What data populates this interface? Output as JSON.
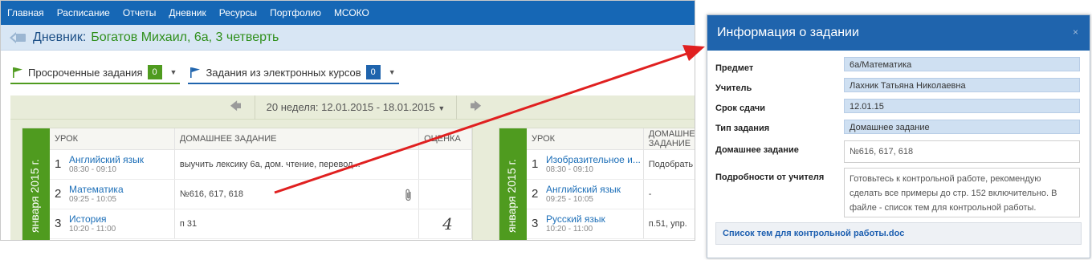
{
  "nav": [
    "Главная",
    "Расписание",
    "Отчеты",
    "Дневник",
    "Ресурсы",
    "Портфолио",
    "МСОКО"
  ],
  "title": {
    "prefix": "Дневник:",
    "name": "Богатов Михаил, 6а, 3 четверть"
  },
  "filters": [
    {
      "label": "Просроченные задания",
      "count": "0"
    },
    {
      "label": "Задания из электронных курсов",
      "count": "0"
    }
  ],
  "week": {
    "label": "20 неделя: 12.01.2015 - 18.01.2015"
  },
  "day1": {
    "date": "января 2015 г.",
    "headers": [
      "УРОК",
      "ДОМАШНЕЕ ЗАДАНИЕ",
      "ОЦЕНКА"
    ],
    "rows": [
      {
        "num": "1",
        "subject": "Английский язык",
        "time": "08:30 - 09:10",
        "homework": "выучить лексику 6а, дом. чтение, перевод...",
        "grade": ""
      },
      {
        "num": "2",
        "subject": "Математика",
        "time": "09:25 - 10:05",
        "homework": "№616, 617, 618",
        "grade": ""
      },
      {
        "num": "3",
        "subject": "История",
        "time": "10:20 - 11:00",
        "homework": "п 31",
        "grade": "4"
      }
    ]
  },
  "day2": {
    "date": "января 2015 г.",
    "headers": [
      "УРОК",
      "ДОМАШНЕЕ ЗАДАНИЕ"
    ],
    "rows": [
      {
        "num": "1",
        "subject": "Изобразительное и...",
        "time": "08:30 - 09:10",
        "homework": "Подобрать"
      },
      {
        "num": "2",
        "subject": "Английский язык",
        "time": "09:25 - 10:05",
        "homework": "-"
      },
      {
        "num": "3",
        "subject": "Русский язык",
        "time": "10:20 - 11:00",
        "homework": "п.51, упр."
      }
    ]
  },
  "modal": {
    "title": "Информация о задании",
    "close": "×",
    "fields": [
      {
        "label": "Предмет",
        "value": "6а/Математика"
      },
      {
        "label": "Учитель",
        "value": "Лахник Татьяна Николаевна"
      },
      {
        "label": "Срок сдачи",
        "value": "12.01.15"
      },
      {
        "label": "Тип задания",
        "value": "Домашнее задание"
      },
      {
        "label": "Домашнее задание",
        "value": "№616, 617, 618"
      },
      {
        "label": "Подробности от учителя",
        "value": "Готовьтесь к контрольной работе, рекомендую сделать все примеры до стр. 152 включительно. В файле - список тем для контрольной работы."
      }
    ],
    "attachment": "Список тем для контрольной работы.doc"
  },
  "colors": {
    "nav": "#1667b5",
    "accent_green": "#4f9b1f",
    "accent_blue": "#1f64ad",
    "arrow": "#e02020"
  }
}
